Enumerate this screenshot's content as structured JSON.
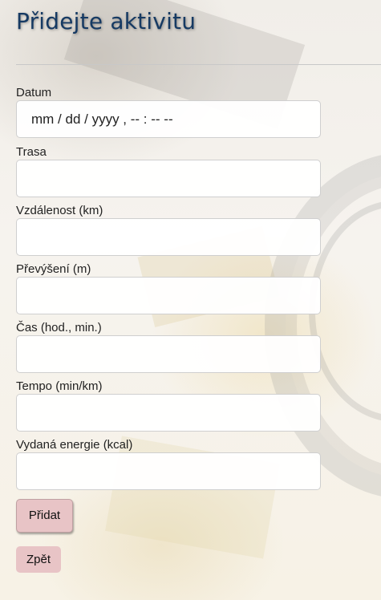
{
  "page": {
    "title": "Přidejte aktivitu"
  },
  "form": {
    "fields": [
      {
        "label": "Datum",
        "value": "mm / dd / yyyy ,  -- : --   --",
        "placeholder": ""
      },
      {
        "label": "Trasa",
        "value": "",
        "placeholder": ""
      },
      {
        "label": "Vzdálenost (km)",
        "value": "",
        "placeholder": ""
      },
      {
        "label": "Převýšení (m)",
        "value": "",
        "placeholder": ""
      },
      {
        "label": "Čas (hod., min.)",
        "value": "",
        "placeholder": ""
      },
      {
        "label": "Tempo (min/km)",
        "value": "",
        "placeholder": ""
      },
      {
        "label": "Vydaná energie (kcal)",
        "value": "",
        "placeholder": ""
      }
    ],
    "submit_label": "Přidat",
    "back_label": "Zpět"
  },
  "colors": {
    "title": "#163a63",
    "button_bg": "#e8c4c6"
  }
}
